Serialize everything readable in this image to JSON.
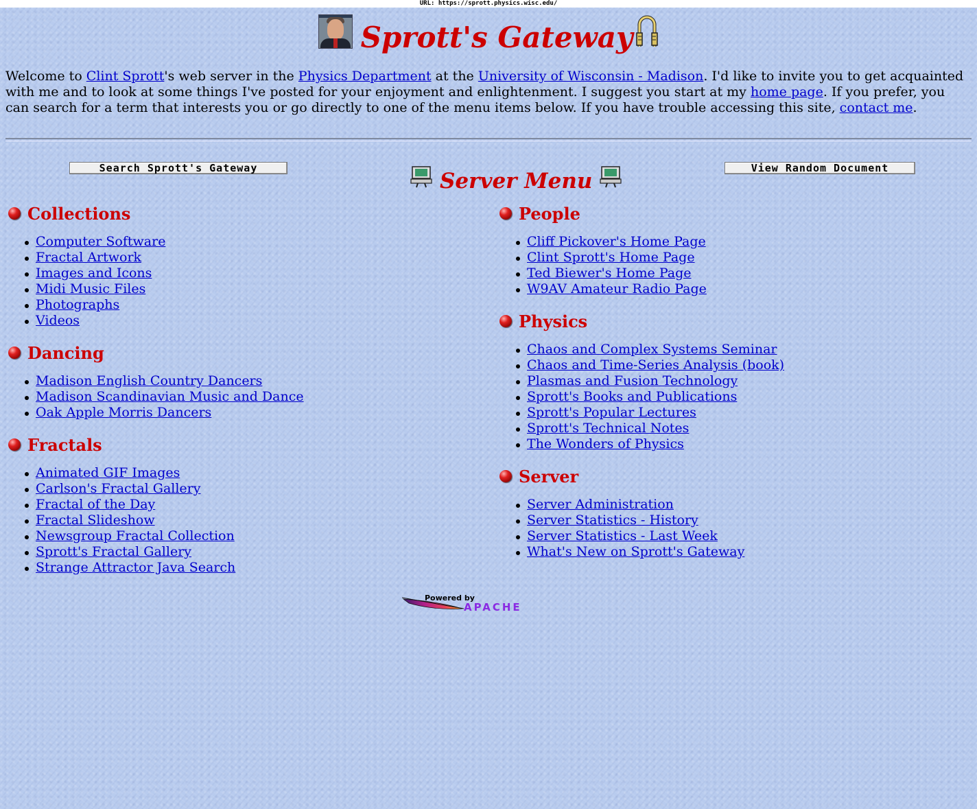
{
  "urlbar": {
    "text": "URL: https://sprott.physics.wisc.edu/"
  },
  "header": {
    "title": "Sprott's Gateway",
    "portrait_icon": "portrait-photo",
    "gate_icon": "gate-icon"
  },
  "intro": {
    "p1": "Welcome to ",
    "link_clint": "Clint Sprott",
    "p2": "'s web server in the ",
    "link_physics": "Physics Department",
    "p3": " at the ",
    "link_uw": "University of Wisconsin - Madison",
    "p4": ". I'd like to invite you to get acquainted with me and to look at some things I've posted for your enjoyment and enlightenment. I suggest you start at my ",
    "link_home": "home page",
    "p5": ". If you prefer, you can search for a term that interests you or go directly to one of the menu items below. If you have trouble accessing this site, ",
    "link_contact": "contact me",
    "p6": "."
  },
  "menu": {
    "search_button": "Search Sprott's Gateway",
    "title": "Server Menu",
    "random_button": "View Random Document"
  },
  "sections_left": {
    "collections": {
      "title": "Collections",
      "items": [
        "Computer Software",
        "Fractal Artwork",
        "Images and Icons",
        "Midi Music Files",
        "Photographs",
        "Videos"
      ]
    },
    "dancing": {
      "title": "Dancing",
      "items": [
        "Madison English Country Dancers",
        "Madison Scandinavian Music and Dance",
        "Oak Apple Morris Dancers"
      ]
    },
    "fractals": {
      "title": "Fractals",
      "items": [
        "Animated GIF Images",
        "Carlson's Fractal Gallery",
        "Fractal of the Day",
        "Fractal Slideshow",
        "Newsgroup Fractal Collection",
        "Sprott's Fractal Gallery",
        "Strange Attractor Java Search"
      ]
    }
  },
  "sections_right": {
    "people": {
      "title": "People",
      "items": [
        "Cliff Pickover's Home Page",
        "Clint Sprott's Home Page",
        "Ted Biewer's Home Page",
        "W9AV Amateur Radio Page"
      ]
    },
    "physics": {
      "title": "Physics",
      "items": [
        "Chaos and Complex Systems Seminar",
        "Chaos and Time-Series Analysis (book)",
        "Plasmas and Fusion Technology",
        "Sprott's Books and Publications",
        "Sprott's Popular Lectures",
        "Sprott's Technical Notes",
        "The Wonders of Physics"
      ]
    },
    "server": {
      "title": "Server",
      "items": [
        "Server Administration",
        "Server Statistics - History",
        "Server Statistics - Last Week",
        "What's New on Sprott's Gateway"
      ]
    }
  },
  "footer": {
    "powered_by": "Powered by",
    "apache": "APACHE"
  },
  "colors": {
    "background": "#b8cbee",
    "heading_red": "#cc0000",
    "link_blue": "#0000cc"
  }
}
